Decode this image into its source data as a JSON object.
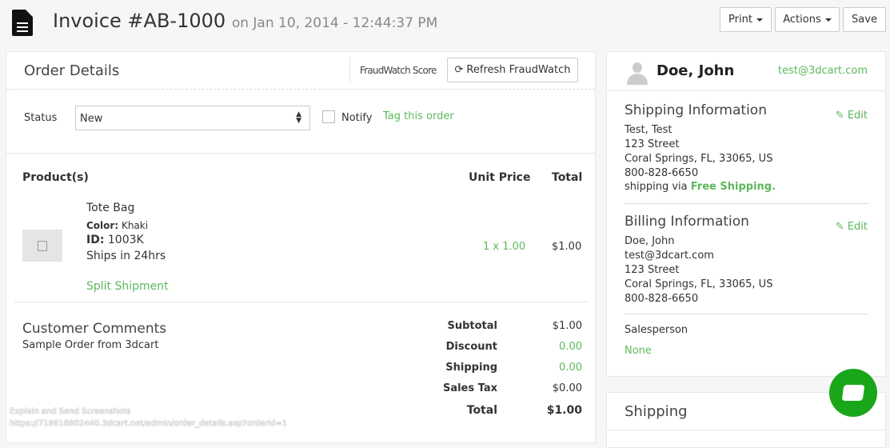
{
  "header": {
    "title": "Invoice #AB-1000",
    "subtitle": "on Jan 10, 2014 - 12:44:37 PM",
    "print": "Print",
    "actions": "Actions",
    "save": "Save"
  },
  "order": {
    "title": "Order Details",
    "fraud_score": "FraudWatch Score",
    "refresh": "Refresh FraudWatch",
    "status_label": "Status",
    "status_value": "New",
    "notify": "Notify",
    "tag": "Tag this order"
  },
  "products": {
    "col_product": "Product(s)",
    "col_unit": "Unit Price",
    "col_total": "Total",
    "item": {
      "name": "Tote Bag",
      "color_label": "Color:",
      "color": "Khaki",
      "id_label": "ID:",
      "id": "1003K",
      "ships": "Ships in 24hrs",
      "qty": "1 x",
      "price": "1.00",
      "total": "$1.00",
      "split": "Split Shipment"
    }
  },
  "comments": {
    "title": "Customer Comments",
    "text": "Sample Order from 3dcart"
  },
  "totals": [
    {
      "label": "Subtotal",
      "value": "$1.00"
    },
    {
      "label": "Discount",
      "value": "0.00"
    },
    {
      "label": "Shipping",
      "value": "0.00"
    },
    {
      "label": "Sales Tax",
      "value": "$0.00"
    },
    {
      "label": "Total",
      "value": "$1.00"
    }
  ],
  "customer": {
    "name": "Doe, John",
    "email": "test@3dcart.com",
    "shipping": {
      "title": "Shipping Information",
      "edit": "Edit",
      "lines": [
        "Test, Test",
        "123 Street",
        "Coral Springs, FL, 33065, US",
        "800-828-6650"
      ],
      "via": "shipping via",
      "method": "Free Shipping."
    },
    "billing": {
      "title": "Billing Information",
      "edit": "Edit",
      "lines": [
        "Doe, John",
        "test@3dcart.com",
        "123 Street",
        "Coral Springs, FL, 33065, US",
        "800-828-6650"
      ]
    },
    "salesperson_label": "Salesperson",
    "salesperson": "None"
  },
  "shipping_panel": {
    "title": "Shipping"
  },
  "overlay": {
    "line1": "Explain and Send Screenshots",
    "line2": "https://719616802440.3dcart.net/admin/order_details.asp?orderid=1"
  },
  "colors": {
    "accent": "#5cb85c",
    "chat": "#19a619"
  }
}
